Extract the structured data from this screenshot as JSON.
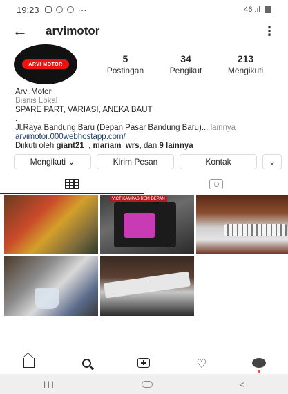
{
  "status_bar": {
    "time": "19:23",
    "dots": "···",
    "signal": "46 .ıl"
  },
  "header": {
    "username": "arvimotor",
    "more": "⋮"
  },
  "profile": {
    "avatar_text": "ARVI MOTOR",
    "stats": [
      {
        "value": "5",
        "label": "Postingan"
      },
      {
        "value": "34",
        "label": "Pengikut"
      },
      {
        "value": "213",
        "label": "Mengikuti"
      }
    ]
  },
  "bio": {
    "name": "Arvi.Motor",
    "category": "Bisnis Lokal",
    "tagline": "SPARE PART, VARIASI, ANEKA BAUT",
    "dot": ".",
    "address": "Jl.Raya Bandung Baru (Depan Pasar Bandung Baru)...",
    "more": "lainnya",
    "website": "arvimotor.000webhostapp.com/",
    "followed_prefix": "Diikuti oleh ",
    "followed_user1": "giant21_",
    "followed_sep": ", ",
    "followed_user2": "mariam_wrs",
    "followed_mid": ", dan ",
    "followed_count": "9 lainnya"
  },
  "actions": {
    "follow": "Mengikuti ⌄",
    "message": "Kirim Pesan",
    "contact": "Kontak",
    "chevron": "⌄"
  },
  "post_texts": {
    "vict": "VICT KAMPAS REM DEPAN"
  },
  "icons": {
    "back": "arrow-left-icon",
    "grid": "grid-icon",
    "tagged": "tagged-icon",
    "home": "home-icon",
    "search": "search-icon",
    "add": "add-post-icon",
    "heart": "heart-icon",
    "profile": "profile-icon"
  },
  "system_nav": {
    "recent": "III",
    "back": "<"
  },
  "colors": {
    "link": "#1e3d6b",
    "secondary": "#8e8e8e",
    "border": "#dbdbdb"
  }
}
